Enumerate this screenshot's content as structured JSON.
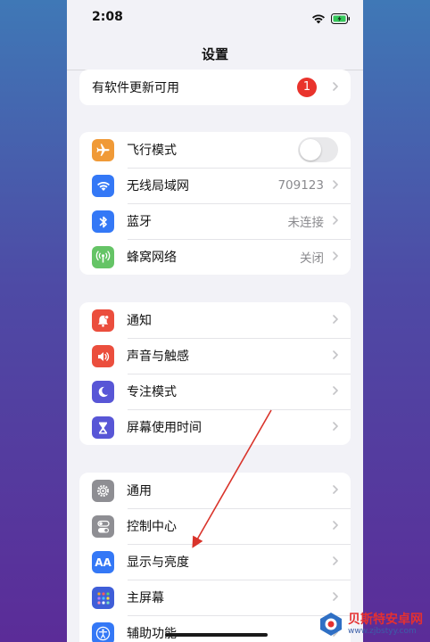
{
  "status_bar": {
    "time": "2:08"
  },
  "nav": {
    "title": "设置"
  },
  "update_row": {
    "label": "有软件更新可用",
    "badge": "1"
  },
  "connectivity": [
    {
      "label": "飞行模式",
      "icon": "airplane-icon",
      "color": "#f09a37",
      "toggle": "off"
    },
    {
      "label": "无线局域网",
      "value": "709123",
      "icon": "wifi-icon",
      "color": "#3478f6"
    },
    {
      "label": "蓝牙",
      "value": "未连接",
      "icon": "bluetooth-icon",
      "color": "#3478f6"
    },
    {
      "label": "蜂窝网络",
      "value": "关闭",
      "icon": "cellular-icon",
      "color": "#65c466"
    }
  ],
  "notifications": [
    {
      "label": "通知",
      "icon": "bell-icon",
      "color": "#eb4e3d"
    },
    {
      "label": "声音与触感",
      "icon": "speaker-icon",
      "color": "#eb4e3d"
    },
    {
      "label": "专注模式",
      "icon": "moon-icon",
      "color": "#5856d6"
    },
    {
      "label": "屏幕使用时间",
      "icon": "hourglass-icon",
      "color": "#5856d6"
    }
  ],
  "general": [
    {
      "label": "通用",
      "icon": "gear-icon",
      "color": "#8e8e93"
    },
    {
      "label": "控制中心",
      "icon": "toggles-icon",
      "color": "#8e8e93"
    },
    {
      "label": "显示与亮度",
      "icon": "aa-icon",
      "color": "#3478f6",
      "icon_text": "AA"
    },
    {
      "label": "主屏幕",
      "icon": "grid-icon",
      "color": "#3f5ed8"
    },
    {
      "label": "辅助功能",
      "icon": "accessibility-icon",
      "color": "#3478f6"
    }
  ],
  "watermark": {
    "name": "贝斯特安卓网",
    "url": "www.zjbstyy.com"
  }
}
